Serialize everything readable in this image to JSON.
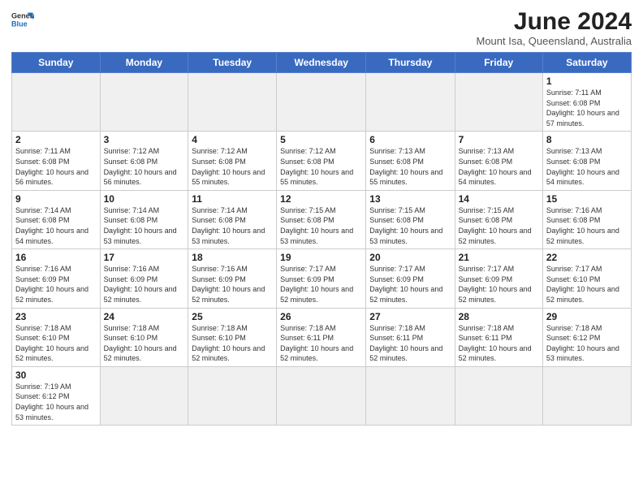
{
  "logo": {
    "text_general": "General",
    "text_blue": "Blue"
  },
  "header": {
    "month_year": "June 2024",
    "location": "Mount Isa, Queensland, Australia"
  },
  "weekdays": [
    "Sunday",
    "Monday",
    "Tuesday",
    "Wednesday",
    "Thursday",
    "Friday",
    "Saturday"
  ],
  "days": {
    "1": {
      "sunrise": "7:11 AM",
      "sunset": "6:08 PM",
      "daylight": "10 hours and 57 minutes."
    },
    "2": {
      "sunrise": "7:11 AM",
      "sunset": "6:08 PM",
      "daylight": "10 hours and 56 minutes."
    },
    "3": {
      "sunrise": "7:12 AM",
      "sunset": "6:08 PM",
      "daylight": "10 hours and 56 minutes."
    },
    "4": {
      "sunrise": "7:12 AM",
      "sunset": "6:08 PM",
      "daylight": "10 hours and 55 minutes."
    },
    "5": {
      "sunrise": "7:12 AM",
      "sunset": "6:08 PM",
      "daylight": "10 hours and 55 minutes."
    },
    "6": {
      "sunrise": "7:13 AM",
      "sunset": "6:08 PM",
      "daylight": "10 hours and 55 minutes."
    },
    "7": {
      "sunrise": "7:13 AM",
      "sunset": "6:08 PM",
      "daylight": "10 hours and 54 minutes."
    },
    "8": {
      "sunrise": "7:13 AM",
      "sunset": "6:08 PM",
      "daylight": "10 hours and 54 minutes."
    },
    "9": {
      "sunrise": "7:14 AM",
      "sunset": "6:08 PM",
      "daylight": "10 hours and 54 minutes."
    },
    "10": {
      "sunrise": "7:14 AM",
      "sunset": "6:08 PM",
      "daylight": "10 hours and 53 minutes."
    },
    "11": {
      "sunrise": "7:14 AM",
      "sunset": "6:08 PM",
      "daylight": "10 hours and 53 minutes."
    },
    "12": {
      "sunrise": "7:15 AM",
      "sunset": "6:08 PM",
      "daylight": "10 hours and 53 minutes."
    },
    "13": {
      "sunrise": "7:15 AM",
      "sunset": "6:08 PM",
      "daylight": "10 hours and 53 minutes."
    },
    "14": {
      "sunrise": "7:15 AM",
      "sunset": "6:08 PM",
      "daylight": "10 hours and 52 minutes."
    },
    "15": {
      "sunrise": "7:16 AM",
      "sunset": "6:08 PM",
      "daylight": "10 hours and 52 minutes."
    },
    "16": {
      "sunrise": "7:16 AM",
      "sunset": "6:09 PM",
      "daylight": "10 hours and 52 minutes."
    },
    "17": {
      "sunrise": "7:16 AM",
      "sunset": "6:09 PM",
      "daylight": "10 hours and 52 minutes."
    },
    "18": {
      "sunrise": "7:16 AM",
      "sunset": "6:09 PM",
      "daylight": "10 hours and 52 minutes."
    },
    "19": {
      "sunrise": "7:17 AM",
      "sunset": "6:09 PM",
      "daylight": "10 hours and 52 minutes."
    },
    "20": {
      "sunrise": "7:17 AM",
      "sunset": "6:09 PM",
      "daylight": "10 hours and 52 minutes."
    },
    "21": {
      "sunrise": "7:17 AM",
      "sunset": "6:09 PM",
      "daylight": "10 hours and 52 minutes."
    },
    "22": {
      "sunrise": "7:17 AM",
      "sunset": "6:10 PM",
      "daylight": "10 hours and 52 minutes."
    },
    "23": {
      "sunrise": "7:18 AM",
      "sunset": "6:10 PM",
      "daylight": "10 hours and 52 minutes."
    },
    "24": {
      "sunrise": "7:18 AM",
      "sunset": "6:10 PM",
      "daylight": "10 hours and 52 minutes."
    },
    "25": {
      "sunrise": "7:18 AM",
      "sunset": "6:10 PM",
      "daylight": "10 hours and 52 minutes."
    },
    "26": {
      "sunrise": "7:18 AM",
      "sunset": "6:11 PM",
      "daylight": "10 hours and 52 minutes."
    },
    "27": {
      "sunrise": "7:18 AM",
      "sunset": "6:11 PM",
      "daylight": "10 hours and 52 minutes."
    },
    "28": {
      "sunrise": "7:18 AM",
      "sunset": "6:11 PM",
      "daylight": "10 hours and 52 minutes."
    },
    "29": {
      "sunrise": "7:18 AM",
      "sunset": "6:12 PM",
      "daylight": "10 hours and 53 minutes."
    },
    "30": {
      "sunrise": "7:19 AM",
      "sunset": "6:12 PM",
      "daylight": "10 hours and 53 minutes."
    }
  }
}
